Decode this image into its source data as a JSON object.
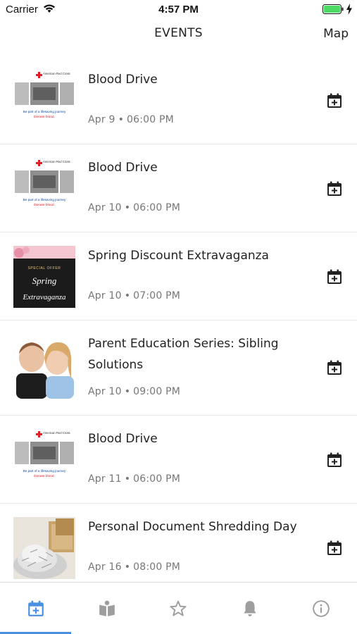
{
  "status_bar": {
    "carrier": "Carrier",
    "time": "4:57 PM"
  },
  "header": {
    "title": "EVENTS",
    "map_label": "Map"
  },
  "events": [
    {
      "title": "Blood Drive",
      "date": "Apr 9",
      "time": "06:00 PM",
      "image": "red-cross-blood-drive"
    },
    {
      "title": "Blood Drive",
      "date": "Apr 10",
      "time": "06:00 PM",
      "image": "red-cross-blood-drive"
    },
    {
      "title": "Spring Discount Extravaganza",
      "date": "Apr 10",
      "time": "07:00 PM",
      "image": "spring-special-offer"
    },
    {
      "title": "Parent Education Series: Sibling Solutions",
      "date": "Apr 10",
      "time": "09:00 PM",
      "image": "siblings-photo"
    },
    {
      "title": "Blood Drive",
      "date": "Apr 11",
      "time": "06:00 PM",
      "image": "red-cross-blood-drive"
    },
    {
      "title": "Personal Document Shredding Day",
      "date": "Apr 16",
      "time": "08:00 PM",
      "image": "shredded-paper"
    }
  ],
  "thumbnails": {
    "red_cross": {
      "org": "American Red Cross",
      "line1": "Be part of a lifesaving journey",
      "line2": "Donate blood."
    },
    "spring": {
      "line1": "SPECIAL OFFER",
      "line2": "Spring",
      "line3": "Extravaganza"
    }
  },
  "tab_bar": {
    "active_index": 0,
    "tabs": [
      "calendar-plus-icon",
      "book-map-icon",
      "star-icon",
      "bell-icon",
      "info-icon"
    ]
  },
  "colors": {
    "accent": "#4a90e2",
    "inactive_icon": "#9e9e9e",
    "meta_text": "#777777",
    "red_cross": "#e41e26"
  }
}
